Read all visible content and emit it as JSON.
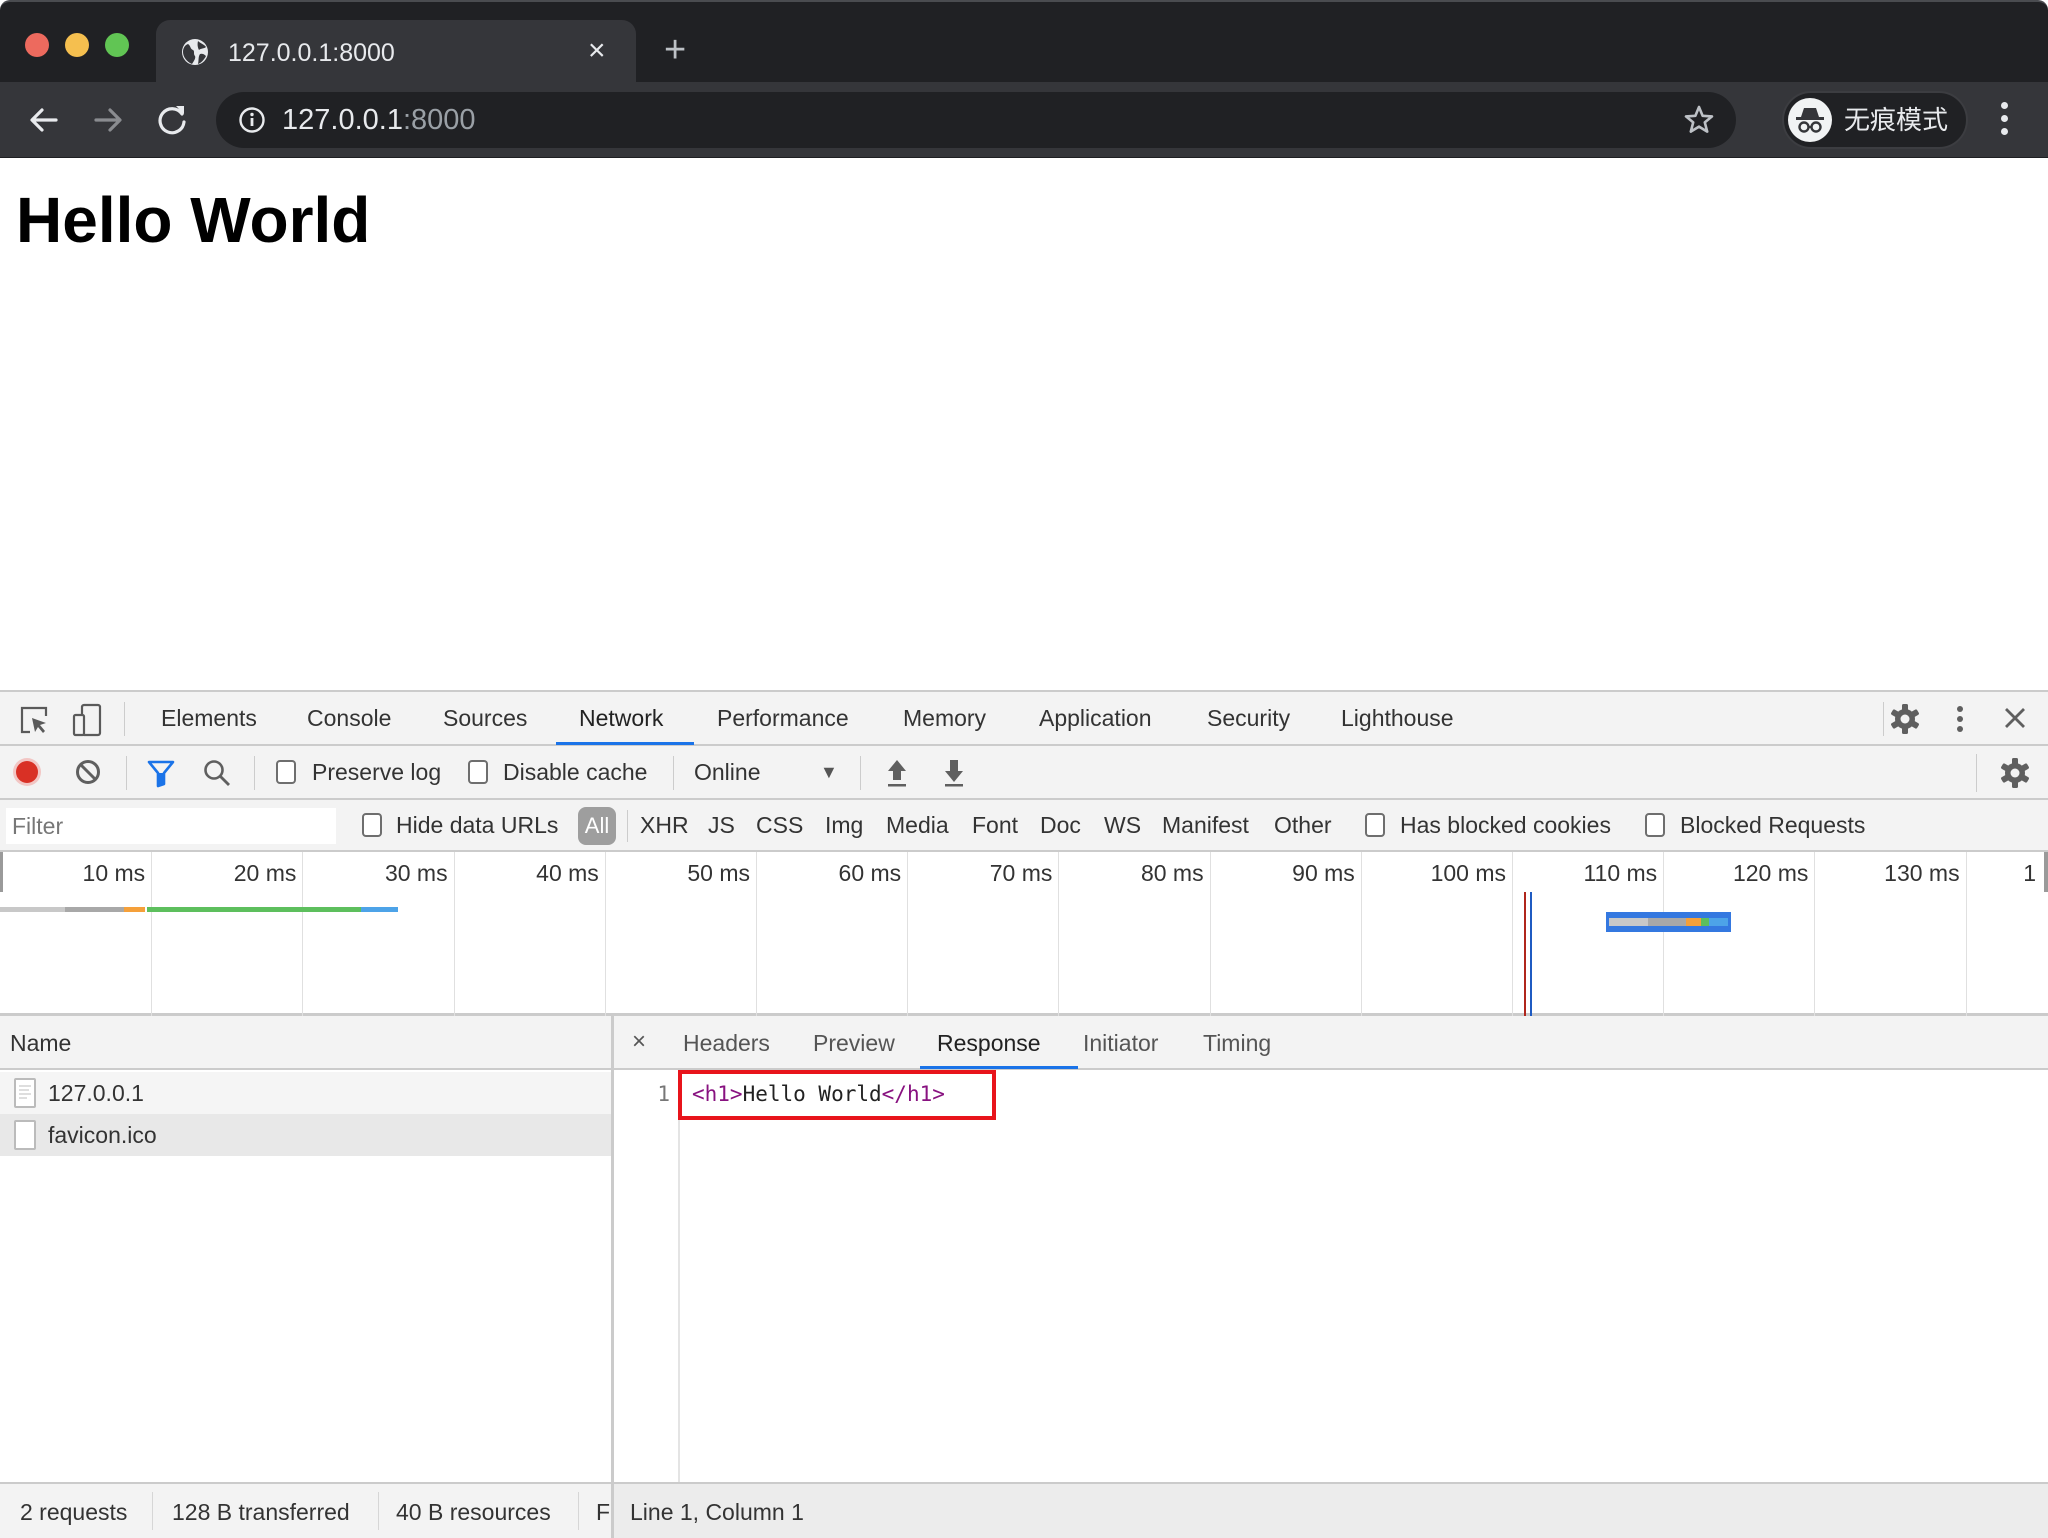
{
  "browser": {
    "tab": {
      "title": "127.0.0.1:8000",
      "icon": "globe-icon",
      "close_glyph": "×"
    },
    "new_tab_glyph": "+",
    "address": {
      "host": "127.0.0.1",
      "port": ":8000"
    },
    "incognito_label": "无痕模式",
    "colors": {
      "close": "#ed6a5e",
      "minimize": "#f5bf4f",
      "maximize": "#61c554"
    }
  },
  "page": {
    "heading": "Hello World"
  },
  "devtools": {
    "tabs": [
      {
        "label": "Elements"
      },
      {
        "label": "Console"
      },
      {
        "label": "Sources"
      },
      {
        "label": "Network",
        "active": true
      },
      {
        "label": "Performance"
      },
      {
        "label": "Memory"
      },
      {
        "label": "Application"
      },
      {
        "label": "Security"
      },
      {
        "label": "Lighthouse"
      }
    ],
    "toolbar": {
      "preserve_log": {
        "label": "Preserve log",
        "checked": false
      },
      "disable_cache": {
        "label": "Disable cache",
        "checked": false
      },
      "throttling": "Online",
      "throttling_caret": "▼"
    },
    "filter_bar": {
      "placeholder": "Filter",
      "hide_data_urls": {
        "label": "Hide data URLs",
        "checked": false
      },
      "types": [
        "All",
        "XHR",
        "JS",
        "CSS",
        "Img",
        "Media",
        "Font",
        "Doc",
        "WS",
        "Manifest",
        "Other"
      ],
      "active_type": "All",
      "has_blocked_cookies": {
        "label": "Has blocked cookies",
        "checked": false
      },
      "blocked_requests": {
        "label": "Blocked Requests",
        "checked": false
      }
    },
    "overview": {
      "ticks": [
        "10 ms",
        "20 ms",
        "30 ms",
        "40 ms",
        "50 ms",
        "60 ms",
        "70 ms",
        "80 ms",
        "90 ms",
        "100 ms",
        "110 ms",
        "120 ms",
        "130 ms",
        "1"
      ],
      "requests": [
        {
          "name": "127.0.0.1",
          "segments": [
            {
              "phase": "queueing",
              "start_ms": 0,
              "end_ms": 4.3,
              "color": "#c8c8c8"
            },
            {
              "phase": "stalled",
              "start_ms": 4.3,
              "end_ms": 8.2,
              "color": "#a8a8a8"
            },
            {
              "phase": "connect",
              "start_ms": 8.2,
              "end_ms": 9.6,
              "color": "#f5a03a"
            },
            {
              "phase": "waiting",
              "start_ms": 9.7,
              "end_ms": 23.9,
              "color": "#5dbf5d"
            },
            {
              "phase": "download",
              "start_ms": 23.9,
              "end_ms": 26.3,
              "color": "#4da3e8"
            }
          ]
        },
        {
          "name": "favicon.ico",
          "selected": true,
          "segments": [
            {
              "phase": "queueing",
              "start_ms": 106.4,
              "end_ms": 109.0,
              "color": "#c8c8c8"
            },
            {
              "phase": "stalled",
              "start_ms": 109.0,
              "end_ms": 111.5,
              "color": "#a8a8a8"
            },
            {
              "phase": "connect",
              "start_ms": 111.5,
              "end_ms": 112.5,
              "color": "#f5a03a"
            },
            {
              "phase": "waiting",
              "start_ms": 112.5,
              "end_ms": 113.0,
              "color": "#5dbf5d"
            },
            {
              "phase": "download",
              "start_ms": 113.0,
              "end_ms": 114.3,
              "color": "#4da3e8"
            }
          ]
        }
      ],
      "markers": [
        {
          "event": "load",
          "at_ms": 100.8,
          "color": "#b0261c"
        },
        {
          "event": "DOMContentLoaded",
          "at_ms": 101.2,
          "color": "#1f5bc2"
        }
      ]
    },
    "requests_table": {
      "header": "Name",
      "rows": [
        {
          "name": "127.0.0.1",
          "icon": "document-icon"
        },
        {
          "name": "favicon.ico",
          "icon": "blank-file-icon",
          "selected": true
        }
      ]
    },
    "detail": {
      "tabs": [
        {
          "label": "Headers"
        },
        {
          "label": "Preview"
        },
        {
          "label": "Response",
          "active": true
        },
        {
          "label": "Initiator"
        },
        {
          "label": "Timing"
        }
      ],
      "close_glyph": "×",
      "line_number": "1",
      "code": {
        "open_tag": "<h1>",
        "text": "Hello World",
        "close_tag": "</h1>"
      },
      "cursor_status": "Line 1, Column 1"
    },
    "summary": {
      "requests": "2 requests",
      "transferred": "128 B transferred",
      "resources": "40 B resources",
      "finish_truncated": "F"
    }
  }
}
